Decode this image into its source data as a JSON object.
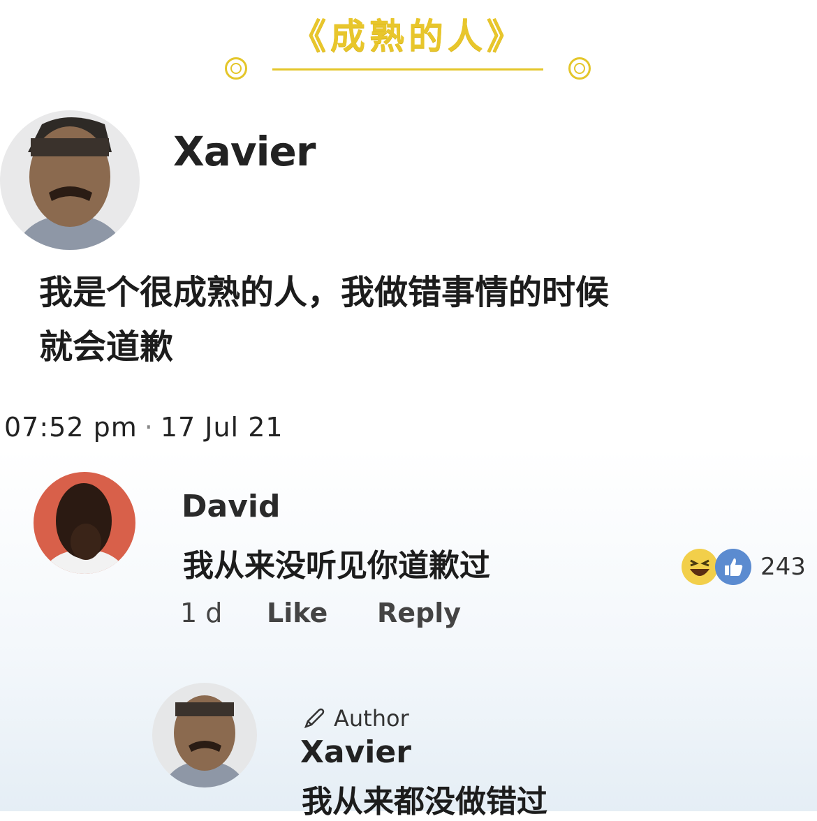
{
  "header": {
    "title": "《成熟的人》"
  },
  "post": {
    "author_name": "Xavier",
    "text_line1": "我是个很成熟的人，我做错事情的时候",
    "text_line2": "就会道歉",
    "time": "07:52 pm",
    "date": "17 Jul 21"
  },
  "comment": {
    "author_name": "David",
    "text": "我从来没听见你道歉过",
    "age": "1 d",
    "like_label": "Like",
    "reply_label": "Reply",
    "reaction_count": "243",
    "reactions": [
      "haha-icon",
      "like-icon"
    ]
  },
  "reply": {
    "badge_label": "Author",
    "author_name": "Xavier",
    "text": "我从来都没做错过"
  },
  "colors": {
    "title_gold": "#e8c62c",
    "like_blue": "#5b8bd0",
    "haha_yellow": "#f2cf4a"
  }
}
